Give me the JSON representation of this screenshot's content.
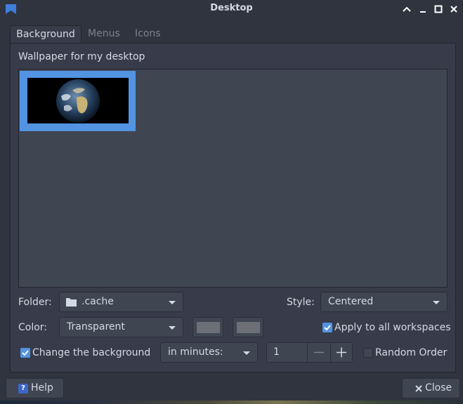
{
  "window": {
    "title": "Desktop",
    "controls": [
      "chevron-up-icon",
      "minimize-icon",
      "maximize-icon",
      "close-icon"
    ]
  },
  "tabs": [
    {
      "label": "Background",
      "active": true
    },
    {
      "label": "Menus",
      "active": false
    },
    {
      "label": "Icons",
      "active": false
    }
  ],
  "wallpaper": {
    "label": "Wallpaper for my desktop",
    "selected_thumbnail": "earth-globe"
  },
  "folder": {
    "label": "Folder:",
    "value": ".cache",
    "icon": "folder-icon"
  },
  "style": {
    "label": "Style:",
    "value": "Centered"
  },
  "color": {
    "label": "Color:",
    "value": "Transparent",
    "swatch_1": "#6c6f76",
    "swatch_2": "#6c6f76"
  },
  "apply_all": {
    "label": "Apply to all workspaces",
    "checked": true
  },
  "change_bg": {
    "label": "Change the background",
    "checked": true
  },
  "interval": {
    "unit": "in minutes:",
    "value": "1"
  },
  "random_order": {
    "label": "Random Order",
    "checked": false
  },
  "footer": {
    "help_label": "Help",
    "close_label": "Close"
  },
  "colors": {
    "accent": "#5294e2",
    "bg": "#2f343f",
    "panel": "#383c4a",
    "field": "#404552",
    "text": "#d3dae3",
    "dim_text": "#7c818c"
  }
}
